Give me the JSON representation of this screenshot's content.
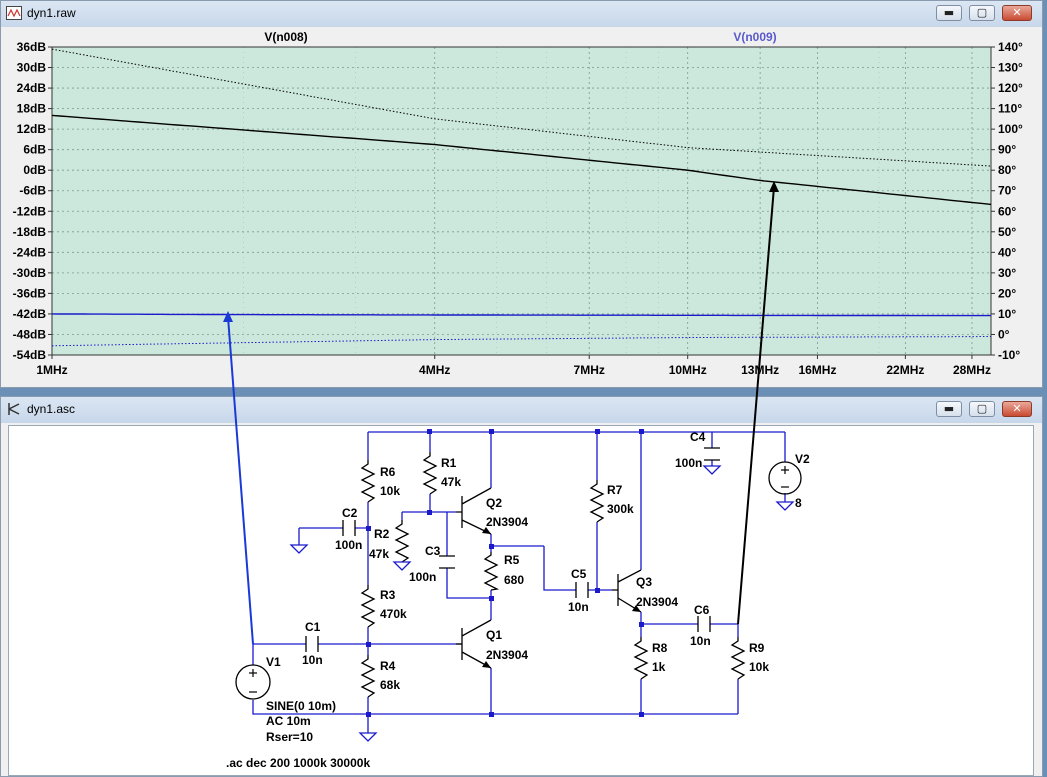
{
  "plot_window": {
    "title": "dyn1.raw",
    "trace_left": "V(n008)",
    "trace_right": "V(n009)",
    "colors": {
      "background": "#cce8dd",
      "grid": "#7a9a8e",
      "trace1": "#000000",
      "trace2": "#1a1acc"
    },
    "window_buttons": {
      "minimize": "▬",
      "maximize": "▢",
      "close": "✕"
    }
  },
  "chart_data": {
    "type": "line",
    "title": "",
    "x_scale": "log",
    "xlabel": "",
    "ylabel_left": "",
    "ylabel_right": "",
    "xlim": [
      1000000,
      30000000
    ],
    "ylim_left": [
      -54,
      36
    ],
    "ylim_right": [
      -10,
      140
    ],
    "x_ticks": [
      "1MHz",
      "4MHz",
      "7MHz",
      "10MHz",
      "13MHz",
      "16MHz",
      "22MHz",
      "28MHz"
    ],
    "x_tick_values": [
      1000000,
      4000000,
      7000000,
      10000000,
      13000000,
      16000000,
      22000000,
      28000000
    ],
    "y_left_ticks": [
      "36dB",
      "30dB",
      "24dB",
      "18dB",
      "12dB",
      "6dB",
      "0dB",
      "-6dB",
      "-12dB",
      "-18dB",
      "-24dB",
      "-30dB",
      "-36dB",
      "-42dB",
      "-48dB",
      "-54dB"
    ],
    "y_right_ticks": [
      "140°",
      "130°",
      "120°",
      "110°",
      "100°",
      "90°",
      "80°",
      "70°",
      "60°",
      "50°",
      "40°",
      "30°",
      "20°",
      "10°",
      "0°",
      "-10°"
    ],
    "grid": true,
    "series": [
      {
        "name": "V(n008)",
        "axis": "left",
        "style": "magnitude",
        "x": [
          1000000,
          4000000,
          10000000,
          13000000,
          30000000
        ],
        "values": [
          16,
          7.5,
          0,
          -3,
          -10
        ]
      },
      {
        "name": "V(n008)",
        "axis": "right",
        "style": "phase",
        "x": [
          1000000,
          4000000,
          10000000,
          30000000
        ],
        "values": [
          139,
          105,
          91,
          82
        ]
      },
      {
        "name": "V(n009)",
        "axis": "left",
        "style": "magnitude",
        "x": [
          1000000,
          2000000,
          4000000,
          10000000,
          30000000
        ],
        "values": [
          -42,
          -42.2,
          -42.3,
          -42.4,
          -42.5
        ]
      },
      {
        "name": "V(n009)",
        "axis": "right",
        "style": "phase",
        "x": [
          1000000,
          4000000,
          10000000,
          30000000
        ],
        "values": [
          -5.5,
          -2.5,
          -1.5,
          -1
        ]
      }
    ]
  },
  "schematic_window": {
    "title": "dyn1.asc",
    "colors": {
      "wire": "#1a1acc",
      "component": "#000000",
      "canvas": "#ffffff",
      "probe_v1": "#1a3ad6",
      "probe_v9": "#000000"
    },
    "components": {
      "R6": "R6",
      "R6_val": "10k",
      "R1": "R1",
      "R1_val": "47k",
      "R2": "R2",
      "R2_val": "47k",
      "R3": "R3",
      "R3_val": "470k",
      "R4": "R4",
      "R4_val": "68k",
      "R5": "R5",
      "R5_val": "680",
      "R7": "R7",
      "R7_val": "300k",
      "R8": "R8",
      "R8_val": "1k",
      "R9": "R9",
      "R9_val": "10k",
      "C1": "C1",
      "C1_val": "10n",
      "C2": "C2",
      "C2_val": "100n",
      "C3": "C3",
      "C3_val": "100n",
      "C4": "C4",
      "C4_val": "100n",
      "C5": "C5",
      "C5_val": "10n",
      "C6": "C6",
      "C6_val": "10n",
      "Q1": "Q1",
      "Q1_model": "2N3904",
      "Q2": "Q2",
      "Q2_model": "2N3904",
      "Q3": "Q3",
      "Q3_model": "2N3904",
      "V1": "V1",
      "V1_line1": "SINE(0 10m)",
      "V1_line2": "AC 10m",
      "V1_line3": "Rser=10",
      "V2": "V2",
      "V2_val": "8"
    },
    "directive": ".ac dec 200 1000k 30000k"
  }
}
